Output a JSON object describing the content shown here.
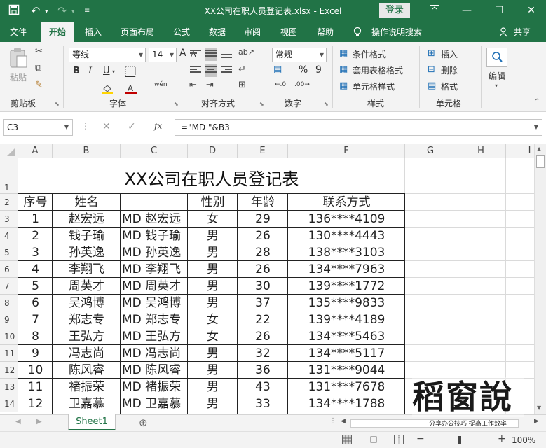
{
  "app": {
    "file_title": "XX公司在职人员登记表.xlsx - Excel",
    "login_label": "登录",
    "share_label": "共享",
    "tell_me": "操作说明搜索"
  },
  "tabs": [
    "文件",
    "开始",
    "插入",
    "页面布局",
    "公式",
    "数据",
    "审阅",
    "视图",
    "帮助"
  ],
  "ribbon": {
    "clipboard": {
      "label": "剪贴板",
      "paste": "粘贴"
    },
    "font": {
      "label": "字体",
      "name": "等线",
      "size": "14",
      "bold": "B",
      "italic": "I",
      "underline": "U",
      "wen": "wén",
      "grow": "A",
      "shrink": "A"
    },
    "alignment": {
      "label": "对齐方式"
    },
    "number": {
      "label": "数字",
      "format": "常规",
      "percent": "%",
      "comma": "9"
    },
    "styles": {
      "label": "样式",
      "conditional": "条件格式",
      "table": "套用表格格式",
      "cell": "单元格样式"
    },
    "cells": {
      "label": "单元格",
      "insert": "插入",
      "delete": "删除",
      "format": "格式"
    },
    "editing": {
      "label": "编辑"
    }
  },
  "formula_bar": {
    "name_box": "C3",
    "fx": "fx",
    "formula": "=\"MD \"&B3"
  },
  "columns": [
    "A",
    "B",
    "C",
    "D",
    "E",
    "F",
    "G",
    "H",
    "I"
  ],
  "rows": [
    "1",
    "2",
    "3",
    "4",
    "5",
    "6",
    "7",
    "8",
    "9",
    "10",
    "11",
    "12",
    "13",
    "14"
  ],
  "sheet": {
    "title": "XX公司在职人员登记表",
    "headers": [
      "序号",
      "姓名",
      "",
      "性别",
      "年龄",
      "联系方式"
    ],
    "records": [
      [
        "1",
        "赵宏远",
        "MD 赵宏远",
        "女",
        "29",
        "136****4109"
      ],
      [
        "2",
        "钱子瑜",
        "MD 钱子瑜",
        "男",
        "26",
        "130****4443"
      ],
      [
        "3",
        "孙英逸",
        "MD 孙英逸",
        "男",
        "28",
        "138****3103"
      ],
      [
        "4",
        "李翔飞",
        "MD 李翔飞",
        "男",
        "26",
        "134****7963"
      ],
      [
        "5",
        "周英才",
        "MD 周英才",
        "男",
        "30",
        "139****1772"
      ],
      [
        "6",
        "吴鸿博",
        "MD 吴鸿博",
        "男",
        "37",
        "135****9833"
      ],
      [
        "7",
        "郑志专",
        "MD 郑志专",
        "女",
        "22",
        "139****4189"
      ],
      [
        "8",
        "王弘方",
        "MD 王弘方",
        "女",
        "26",
        "134****5463"
      ],
      [
        "9",
        "冯志尚",
        "MD 冯志尚",
        "男",
        "32",
        "134****5117"
      ],
      [
        "10",
        "陈风睿",
        "MD 陈风睿",
        "男",
        "36",
        "131****9044"
      ],
      [
        "11",
        "褚振荣",
        "MD 褚振荣",
        "男",
        "43",
        "131****7678"
      ],
      [
        "12",
        "卫嘉慕",
        "MD 卫嘉慕",
        "男",
        "33",
        "134****1788"
      ]
    ]
  },
  "sheet_tabs": [
    "Sheet1"
  ],
  "status": {
    "zoom": "100%"
  },
  "watermark": {
    "brand": "稻窗說",
    "slogan": "分享办公技巧 提高工作效率"
  },
  "colors": {
    "brand_green": "#217346"
  }
}
